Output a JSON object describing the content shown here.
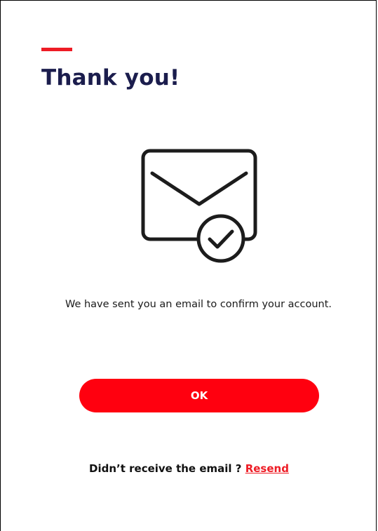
{
  "header": {
    "title": "Thank you!",
    "accent_color": "#ee1c25",
    "title_color": "#1b1d4d"
  },
  "illustration": {
    "icon": "email-sent-check-icon"
  },
  "main": {
    "message": "We have sent you an email to confirm your account."
  },
  "actions": {
    "ok_label": "OK",
    "button_color": "#ff000f"
  },
  "footer": {
    "prompt": "Didn’t receive the email ?",
    "resend_label": "Resend"
  }
}
